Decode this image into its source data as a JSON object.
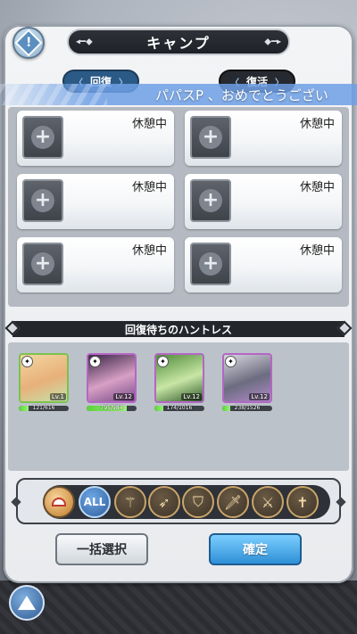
{
  "header": {
    "title": "キャンプ",
    "info_icon": "!"
  },
  "tabs": [
    {
      "label": "回復",
      "active": true
    },
    {
      "label": "復活",
      "active": false
    }
  ],
  "marquee": {
    "text": "パパスP 、おめでとうござい"
  },
  "slots": [
    {
      "status": "休憩中"
    },
    {
      "status": "休憩中"
    },
    {
      "status": "休憩中"
    },
    {
      "status": "休憩中"
    },
    {
      "status": "休憩中"
    },
    {
      "status": "休憩中"
    }
  ],
  "waiting_section": {
    "title": "回復待ちのハントレス",
    "hunters": [
      {
        "level": "Lv.1",
        "hp": "121/616",
        "hp_fraction": 0.2,
        "frame_color": "#7cc24e",
        "colors": [
          "#f4d6a0",
          "#e8b07a",
          "#c4e3a8"
        ]
      },
      {
        "level": "Lv.12",
        "hp": "795/984",
        "hp_fraction": 0.81,
        "frame_color": "#b466c6",
        "colors": [
          "#3a2648",
          "#d7a0c4",
          "#7a4c8a"
        ]
      },
      {
        "level": "Lv.12",
        "hp": "174/1016",
        "hp_fraction": 0.17,
        "frame_color": "#b466c6",
        "colors": [
          "#4f8c3a",
          "#c8e6a6",
          "#2f5a2a"
        ]
      },
      {
        "level": "Lv.12",
        "hp": "238/1526",
        "hp_fraction": 0.16,
        "frame_color": "#b466c6",
        "colors": [
          "#d8d8e0",
          "#6c6c80",
          "#b08ac8"
        ]
      }
    ]
  },
  "filters": {
    "all_label": "ALL",
    "icons": [
      "type-icon",
      "all-icon",
      "staff-icon",
      "bow-icon",
      "shield-icon",
      "sword-icon",
      "crossed-swords-icon",
      "cross-icon"
    ]
  },
  "buttons": {
    "select_all": "一括選択",
    "confirm": "確定"
  }
}
